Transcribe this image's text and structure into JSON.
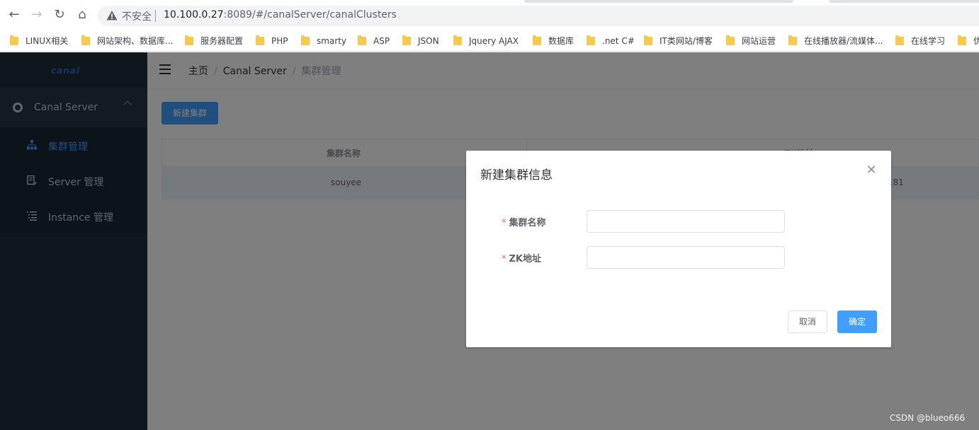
{
  "browser": {
    "insecure_label": "不安全",
    "url_host": "10.100.0.27",
    "url_rest": ":8089/#/canalServer/canalClusters"
  },
  "bookmarks": [
    "LINUX相关",
    "网站架构、数据库...",
    "服务器配置",
    "PHP",
    "smarty",
    "ASP",
    "JSON",
    "Jquery AJAX",
    "数据库",
    ".net C#",
    "IT类网站/博客",
    "网站运营",
    "在线播放器/流媒体...",
    "在线学习",
    "优"
  ],
  "sidebar": {
    "logo": "canal",
    "group_label": "Canal Server",
    "items": [
      {
        "label": "集群管理",
        "active": true
      },
      {
        "label": "Server 管理",
        "active": false
      },
      {
        "label": "Instance 管理",
        "active": false
      }
    ]
  },
  "breadcrumb": {
    "home": "主页",
    "section": "Canal Server",
    "current": "集群管理"
  },
  "toolbar": {
    "add_label": "新建集群"
  },
  "table": {
    "columns": [
      "集群名称",
      "ZK地址"
    ],
    "rows": [
      {
        "name": "souyee",
        "zk": "...81"
      }
    ]
  },
  "dialog": {
    "title": "新建集群信息",
    "fields": [
      {
        "label": "集群名称",
        "required": true,
        "value": ""
      },
      {
        "label": "ZK地址",
        "required": true,
        "value": ""
      }
    ],
    "cancel_label": "取消",
    "ok_label": "确定"
  },
  "watermark": "CSDN @blueo666",
  "colors": {
    "primary": "#409eff",
    "sidebar_bg": "#1f2d3d",
    "required_star": "#f56c6c"
  }
}
